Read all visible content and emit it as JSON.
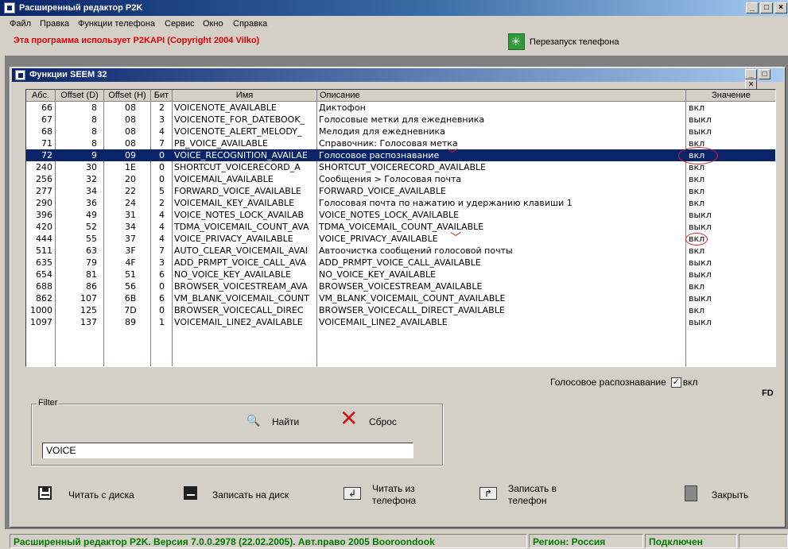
{
  "app": {
    "title": "Расширенный редактор P2K"
  },
  "menu": [
    "Файл",
    "Правка",
    "Функции телефона",
    "Сервис",
    "Окно",
    "Справка"
  ],
  "warning": "Эта программа использует P2KAPI (Copyright 2004 Vilko)",
  "restart_label": "Перезапуск телефона",
  "child_window": {
    "title": "Функции SEEM 32"
  },
  "table": {
    "headers": [
      "Абс.",
      "Offset (D)",
      "Offset (H)",
      "Бит",
      "Имя",
      "Описание",
      "Значение"
    ],
    "rows": [
      [
        "66",
        "8",
        "08",
        "2",
        "VOICENOTE_AVAILABLE",
        "Диктофон",
        "вкл"
      ],
      [
        "67",
        "8",
        "08",
        "3",
        "VOICENOTE_FOR_DATEBOOK_",
        "Голосовые метки для ежедневника",
        "выкл"
      ],
      [
        "68",
        "8",
        "08",
        "4",
        "VOICENOTE_ALERT_MELODY_",
        "Мелодия для ежедневника",
        "выкл"
      ],
      [
        "71",
        "8",
        "08",
        "7",
        "PB_VOICE_AVAILABLE",
        "Справочник: Голосовая метка",
        "вкл"
      ],
      [
        "72",
        "9",
        "09",
        "0",
        "VOICE_RECOGNITION_AVAILAE",
        "Голосовое распознавание",
        "вкл"
      ],
      [
        "240",
        "30",
        "1E",
        "0",
        "SHORTCUT_VOICERECORD_A",
        "SHORTCUT_VOICERECORD_AVAILABLE",
        "вкл"
      ],
      [
        "256",
        "32",
        "20",
        "0",
        "VOICEMAIL_AVAILABLE",
        "Сообщения > Голосовая почта",
        "вкл"
      ],
      [
        "277",
        "34",
        "22",
        "5",
        "FORWARD_VOICE_AVAILABLE",
        "FORWARD_VOICE_AVAILABLE",
        "вкл"
      ],
      [
        "290",
        "36",
        "24",
        "2",
        "VOICEMAIL_KEY_AVAILABLE",
        "Голосовая почта по нажатию и удержанию клавиши 1",
        "вкл"
      ],
      [
        "396",
        "49",
        "31",
        "4",
        "VOICE_NOTES_LOCK_AVAILAB",
        "VOICE_NOTES_LOCK_AVAILABLE",
        "выкл"
      ],
      [
        "420",
        "52",
        "34",
        "4",
        "TDMA_VOICEMAIL_COUNT_AVA",
        "TDMA_VOICEMAIL_COUNT_AVAILABLE",
        "выкл"
      ],
      [
        "444",
        "55",
        "37",
        "4",
        "VOICE_PRIVACY_AVAILABLE",
        "VOICE_PRIVACY_AVAILABLE",
        "вкл"
      ],
      [
        "511",
        "63",
        "3F",
        "7",
        "AUTO_CLEAR_VOICEMAIL_AVAI",
        "Автоочистка сообщений голосовой почты",
        "вкл"
      ],
      [
        "635",
        "79",
        "4F",
        "3",
        "ADD_PRMPT_VOICE_CALL_AVA",
        "ADD_PRMPT_VOICE_CALL_AVAILABLE",
        "выкл"
      ],
      [
        "654",
        "81",
        "51",
        "6",
        "NO_VOICE_KEY_AVAILABLE",
        "NO_VOICE_KEY_AVAILABLE",
        "выкл"
      ],
      [
        "688",
        "86",
        "56",
        "0",
        "BROWSER_VOICESTREAM_AVA",
        "BROWSER_VOICESTREAM_AVAILABLE",
        "вкл"
      ],
      [
        "862",
        "107",
        "6B",
        "6",
        "VM_BLANK_VOICEMAIL_COUNT",
        "VM_BLANK_VOICEMAIL_COUNT_AVAILABLE",
        "выкл"
      ],
      [
        "1000",
        "125",
        "7D",
        "0",
        "BROWSER_VOICECALL_DIREC",
        "BROWSER_VOICECALL_DIRECT_AVAILABLE",
        "вкл"
      ],
      [
        "1097",
        "137",
        "89",
        "1",
        "VOICEMAIL_LINE2_AVAILABLE",
        "VOICEMAIL_LINE2_AVAILABLE",
        "выкл"
      ]
    ],
    "selected_index": 4
  },
  "voice_check": {
    "label": "Голосовое распознавание",
    "value": "вкл",
    "checked": true
  },
  "fd_label": "FD",
  "filter": {
    "legend": "Filter",
    "find_label": "Найти",
    "reset_label": "Сброс",
    "value": "VOICE"
  },
  "buttons": {
    "read_disk": "Читать с диска",
    "write_disk": "Записать на диск",
    "read_phone_1": "Читать из",
    "read_phone_2": "телефона",
    "write_phone_1": "Записать в",
    "write_phone_2": "телефон",
    "close": "Закрыть"
  },
  "status": {
    "version": "Расширенный редактор P2K. Версия 7.0.0.2978 (22.02.2005). Авт.право 2005 Booroondook",
    "region": "Регион: Россия",
    "connection": "Подключен"
  }
}
